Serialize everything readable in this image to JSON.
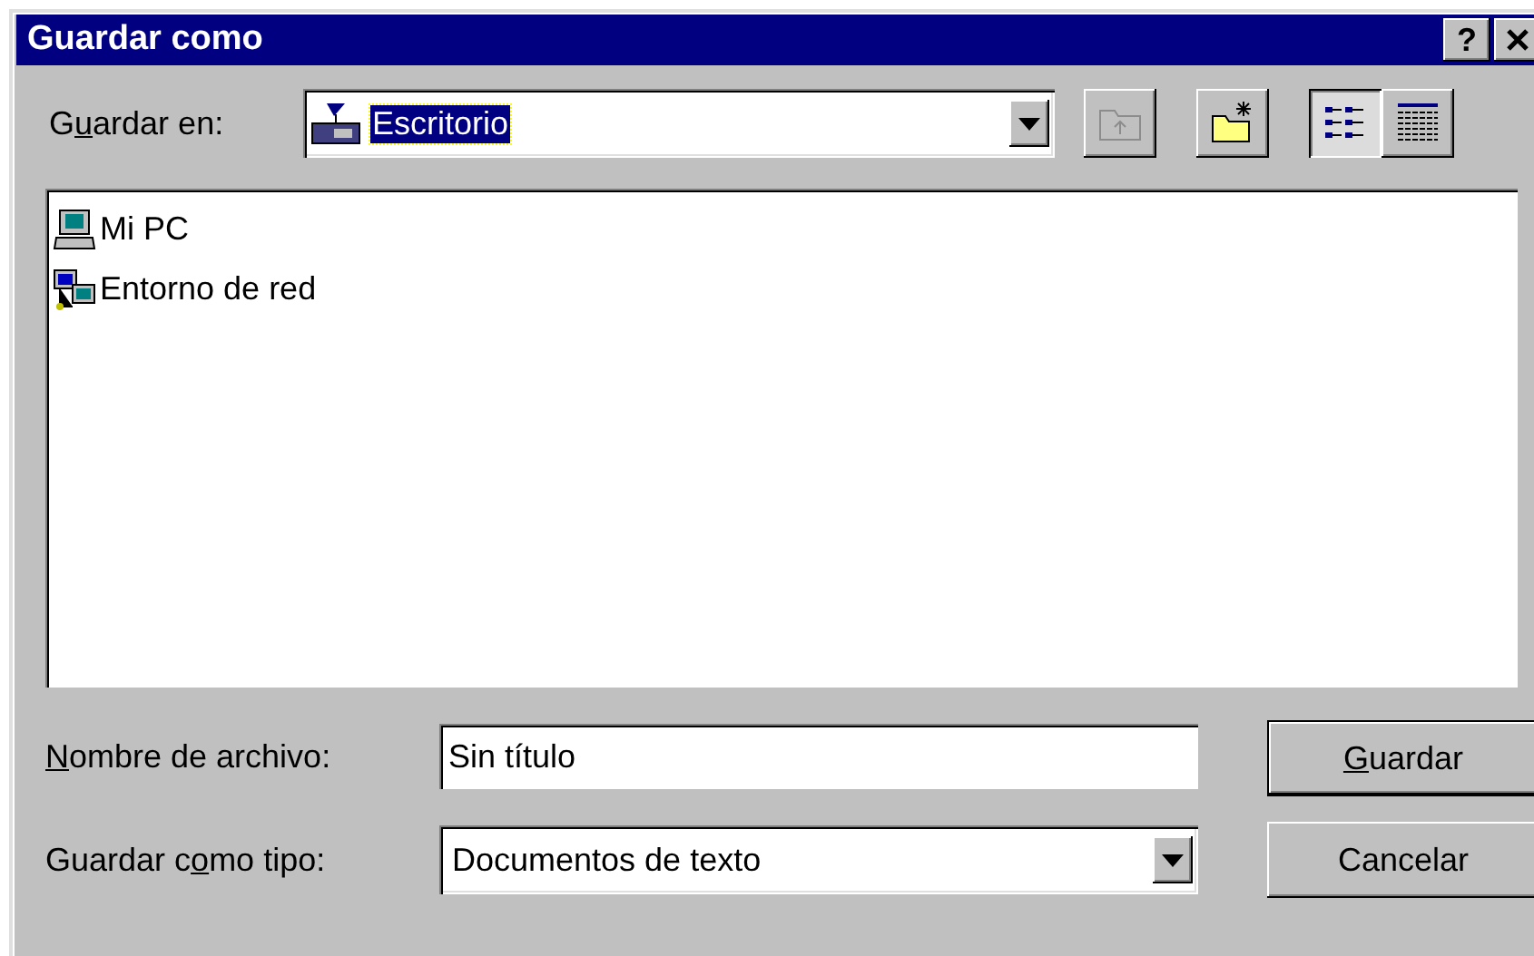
{
  "window": {
    "title": "Guardar como",
    "controls": [
      {
        "kind": "help",
        "label": "?"
      },
      {
        "kind": "close"
      }
    ]
  },
  "save_in": {
    "label_parts": [
      {
        "text": "G",
        "underlined": false
      },
      {
        "text": "u",
        "underlined": true
      },
      {
        "text": "ardar en:",
        "underlined": false
      }
    ],
    "value": "Escritorio",
    "selected": true
  },
  "toolbar": [
    {
      "kind": "up",
      "disabled": true
    },
    {
      "kind": "new-folder",
      "disabled": false
    },
    {
      "kind": "list",
      "selected": true
    },
    {
      "kind": "details",
      "selected": false
    }
  ],
  "files": [
    {
      "name": "Mi PC",
      "kind": "computer"
    },
    {
      "name": "Entorno de red",
      "kind": "network"
    }
  ],
  "file_name": {
    "label_parts": [
      {
        "text": "N",
        "underlined": true
      },
      {
        "text": "ombre de archivo:",
        "underlined": false
      }
    ],
    "value": "Sin título"
  },
  "file_type": {
    "label_parts": [
      {
        "text": "Guardar c",
        "underlined": false
      },
      {
        "text": "o",
        "underlined": true
      },
      {
        "text": "mo tipo:",
        "underlined": false
      }
    ],
    "value": "Documentos de texto"
  },
  "buttons": [
    {
      "label_parts": [
        {
          "text": "G",
          "underlined": true
        },
        {
          "text": "uardar",
          "underlined": false
        }
      ],
      "default": true
    },
    {
      "label_parts": [
        {
          "text": "Cancelar",
          "underlined": false
        }
      ],
      "default": false
    }
  ]
}
